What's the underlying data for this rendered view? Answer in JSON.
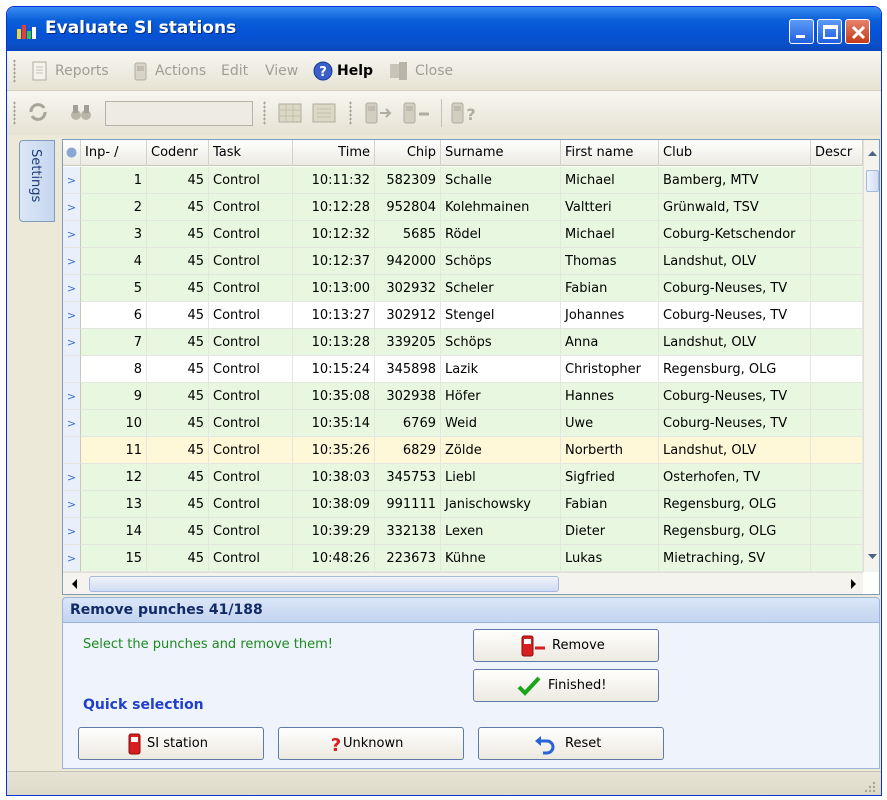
{
  "window": {
    "title": "Evaluate SI stations"
  },
  "menu": {
    "reports": "Reports",
    "actions": "Actions",
    "edit": "Edit",
    "view": "View",
    "help": "Help",
    "close": "Close"
  },
  "sidebar": {
    "settings_tab": "Settings"
  },
  "grid": {
    "columns": {
      "input": "Inp‐ /",
      "codenr": "Codenr",
      "task": "Task",
      "time": "Time",
      "chip": "Chip",
      "surname": "Surname",
      "first_name": "First name",
      "club": "Club",
      "descr": "Descr"
    },
    "rows": [
      {
        "n": "1",
        "code": "45",
        "task": "Control",
        "time": "10:11:32",
        "chip": "582309",
        "surname": "Schalle",
        "first": "Michael",
        "club": "Bamberg, MTV",
        "color": "green",
        "arrow": true
      },
      {
        "n": "2",
        "code": "45",
        "task": "Control",
        "time": "10:12:28",
        "chip": "952804",
        "surname": "Kolehmainen",
        "first": "Valtteri",
        "club": "Grünwald, TSV",
        "color": "green",
        "arrow": true
      },
      {
        "n": "3",
        "code": "45",
        "task": "Control",
        "time": "10:12:32",
        "chip": "5685",
        "surname": "Rödel",
        "first": "Michael",
        "club": "Coburg-Ketschendor",
        "color": "green",
        "arrow": true
      },
      {
        "n": "4",
        "code": "45",
        "task": "Control",
        "time": "10:12:37",
        "chip": "942000",
        "surname": "Schöps",
        "first": "Thomas",
        "club": "Landshut, OLV",
        "color": "green",
        "arrow": true
      },
      {
        "n": "5",
        "code": "45",
        "task": "Control",
        "time": "10:13:00",
        "chip": "302932",
        "surname": "Scheler",
        "first": "Fabian",
        "club": "Coburg-Neuses, TV",
        "color": "green",
        "arrow": true
      },
      {
        "n": "6",
        "code": "45",
        "task": "Control",
        "time": "10:13:27",
        "chip": "302912",
        "surname": "Stengel",
        "first": "Johannes",
        "club": "Coburg-Neuses, TV",
        "color": "white",
        "arrow": true
      },
      {
        "n": "7",
        "code": "45",
        "task": "Control",
        "time": "10:13:28",
        "chip": "339205",
        "surname": "Schöps",
        "first": "Anna",
        "club": "Landshut, OLV",
        "color": "green",
        "arrow": true
      },
      {
        "n": "8",
        "code": "45",
        "task": "Control",
        "time": "10:15:24",
        "chip": "345898",
        "surname": "Lazik",
        "first": "Christopher",
        "club": "Regensburg, OLG",
        "color": "white",
        "arrow": false
      },
      {
        "n": "9",
        "code": "45",
        "task": "Control",
        "time": "10:35:08",
        "chip": "302938",
        "surname": "Höfer",
        "first": "Hannes",
        "club": "Coburg-Neuses, TV",
        "color": "green",
        "arrow": true
      },
      {
        "n": "10",
        "code": "45",
        "task": "Control",
        "time": "10:35:14",
        "chip": "6769",
        "surname": "Weid",
        "first": "Uwe",
        "club": "Coburg-Neuses, TV",
        "color": "green",
        "arrow": true
      },
      {
        "n": "11",
        "code": "45",
        "task": "Control",
        "time": "10:35:26",
        "chip": "6829",
        "surname": "Zölde",
        "first": "Norberth",
        "club": "Landshut, OLV",
        "color": "yellow",
        "arrow": false
      },
      {
        "n": "12",
        "code": "45",
        "task": "Control",
        "time": "10:38:03",
        "chip": "345753",
        "surname": "Liebl",
        "first": "Sigfried",
        "club": "Osterhofen, TV",
        "color": "green",
        "arrow": true
      },
      {
        "n": "13",
        "code": "45",
        "task": "Control",
        "time": "10:38:09",
        "chip": "991111",
        "surname": "Janischowsky",
        "first": "Fabian",
        "club": "Regensburg, OLG",
        "color": "green",
        "arrow": true
      },
      {
        "n": "14",
        "code": "45",
        "task": "Control",
        "time": "10:39:29",
        "chip": "332138",
        "surname": "Lexen",
        "first": "Dieter",
        "club": "Regensburg, OLG",
        "color": "green",
        "arrow": true
      },
      {
        "n": "15",
        "code": "45",
        "task": "Control",
        "time": "10:48:26",
        "chip": "223673",
        "surname": "Kühne",
        "first": "Lukas",
        "club": "Mietraching, SV",
        "color": "green",
        "arrow": true
      }
    ]
  },
  "panel": {
    "title": "Remove punches  41/188",
    "hint": "Select the punches and remove them!",
    "quick_selection": "Quick selection",
    "remove_label": "Remove",
    "finished_label": "Finished!",
    "si_station_label": "SI station",
    "unknown_label": "Unknown",
    "reset_label": "Reset"
  },
  "colors": {
    "row_green": "#e8f8e0",
    "row_white": "#ffffff",
    "row_yellow": "#fff8d8",
    "hint_green": "#1f8a1f",
    "quick_blue": "#1f3fcc"
  }
}
